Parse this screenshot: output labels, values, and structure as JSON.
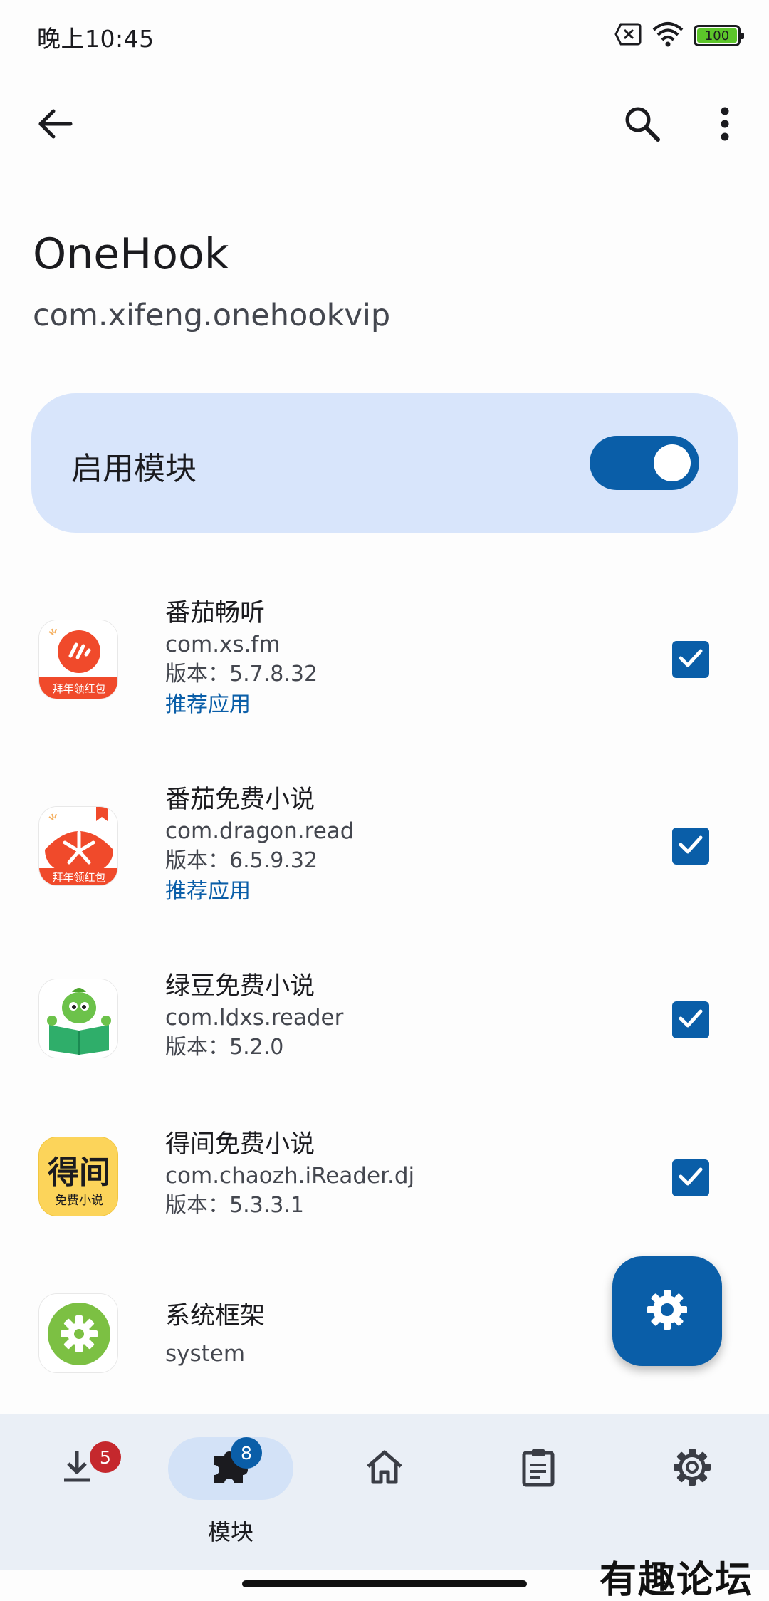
{
  "status_bar": {
    "time": "晚上10:45",
    "battery": "100",
    "icons": [
      "sim-off-icon",
      "wifi-icon",
      "battery-icon"
    ]
  },
  "app_bar": {
    "icons": [
      "back-arrow-icon",
      "search-icon",
      "more-vert-icon"
    ]
  },
  "module": {
    "name": "OneHook",
    "package": "com.xifeng.onehookvip"
  },
  "enable_card": {
    "label": "启用模块",
    "enabled": true
  },
  "scope_apps": [
    {
      "name": "番茄畅听",
      "package": "com.xs.fm",
      "version": "版本：5.7.8.32",
      "recommended": "推荐应用",
      "checked": true,
      "icon_text": "拜年领红包"
    },
    {
      "name": "番茄免费小说",
      "package": "com.dragon.read",
      "version": "版本：6.5.9.32",
      "recommended": "推荐应用",
      "checked": true,
      "icon_text": "拜年领红包"
    },
    {
      "name": "绿豆免费小说",
      "package": "com.ldxs.reader",
      "version": "版本：5.2.0",
      "checked": true
    },
    {
      "name": "得间免费小说",
      "package": "com.chaozh.iReader.dj",
      "version": "版本：5.3.3.1",
      "checked": true,
      "icon_text": "得间",
      "icon_subtext": "免费小说"
    },
    {
      "name": "系统框架",
      "package": "system"
    }
  ],
  "fab": {
    "icon": "settings-icon"
  },
  "bottom_nav": {
    "items": [
      {
        "id": "repository",
        "icon": "download-icon",
        "badge": "5"
      },
      {
        "id": "modules",
        "icon": "puzzle-icon",
        "badge": "8",
        "label": "模块",
        "active": true
      },
      {
        "id": "home",
        "icon": "home-icon"
      },
      {
        "id": "logs",
        "icon": "clipboard-icon"
      },
      {
        "id": "settings",
        "icon": "settings-icon"
      }
    ]
  },
  "watermark": "有趣论坛",
  "colors": {
    "accent": "#0a5ea8",
    "card_bg": "#d8e5fb",
    "nav_bg": "#eaeff6",
    "badge_red": "#c5282d"
  }
}
